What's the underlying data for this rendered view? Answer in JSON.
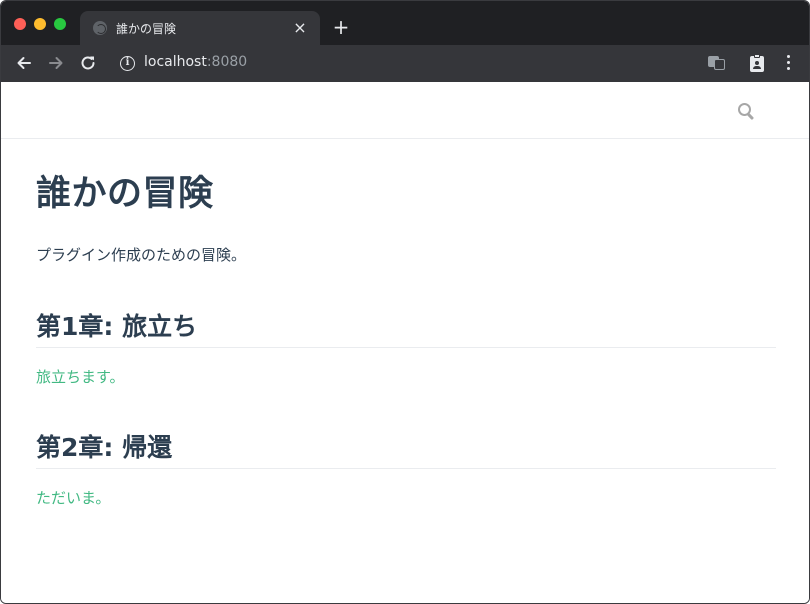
{
  "browser": {
    "tab_title": "誰かの冒険",
    "tab_close": "×",
    "new_tab": "+",
    "url_host": "localhost",
    "url_port": ":8080",
    "icons": {
      "back": "arrow-left-icon",
      "forward": "arrow-right-icon",
      "reload": "reload-icon",
      "info": "info-icon",
      "translate": "translate-icon",
      "clipboard": "clipboard-person-icon",
      "menu": "kebab-menu-icon"
    }
  },
  "page": {
    "navbar": {
      "search_icon": "search-icon"
    },
    "title": "誰かの冒険",
    "description": "プラグイン作成のための冒険。",
    "chapters": [
      {
        "heading": "第1章: 旅立ち",
        "text": "旅立ちます。"
      },
      {
        "heading": "第2章: 帰還",
        "text": "ただいま。"
      }
    ]
  },
  "colors": {
    "heading": "#2c3e50",
    "accent": "#42b983",
    "chrome_dark": "#1f2023",
    "chrome_toolbar": "#35363a"
  }
}
